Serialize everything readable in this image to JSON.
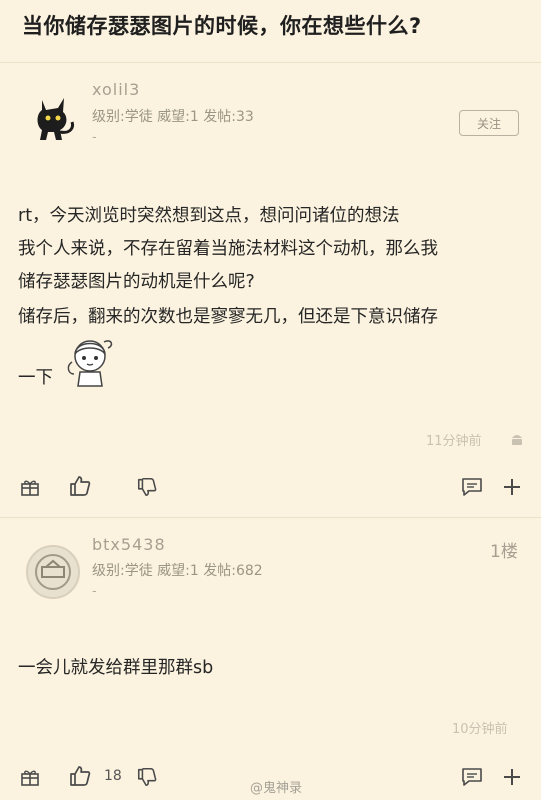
{
  "page_title": "当你储存瑟瑟图片的时候，你在想些什么?",
  "post": {
    "username": "xolil3",
    "meta": "级别:学徒 威望:1 发帖:33",
    "meta_dash": "-",
    "follow_label": "关注",
    "lines": [
      "rt，今天浏览时突然想到这点，想问问诸位的想法",
      "我个人来说，不存在留着当施法材料这个动机，那么我",
      "储存瑟瑟图片的动机是什么呢?",
      "储存后，翻来的次数也是寥寥无几，但还是下意识储存",
      "一下"
    ],
    "time": "11分钟前"
  },
  "reply": {
    "username": "btx5438",
    "meta": "级别:学徒 威望:1 发帖:682",
    "meta_dash": "-",
    "floor": "1楼",
    "text": "一会儿就发给群里那群sb",
    "time": "10分钟前",
    "like_count": "18"
  },
  "watermark": "@鬼神录",
  "colors": {
    "background": "#fbf3df",
    "icon": "#4a4a4a"
  }
}
